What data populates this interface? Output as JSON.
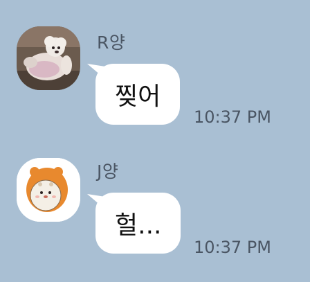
{
  "messages": [
    {
      "sender": "R양",
      "avatar_icon": "poodle-dog-avatar-icon",
      "text": "찢어",
      "time": "10:37 PM"
    },
    {
      "sender": "J양",
      "avatar_icon": "hamster-cartoon-avatar-icon",
      "text": "헐...",
      "time": "10:37 PM"
    }
  ],
  "colors": {
    "background": "#a9bfd3",
    "bubble": "#ffffff",
    "meta_text": "#4a5563"
  }
}
